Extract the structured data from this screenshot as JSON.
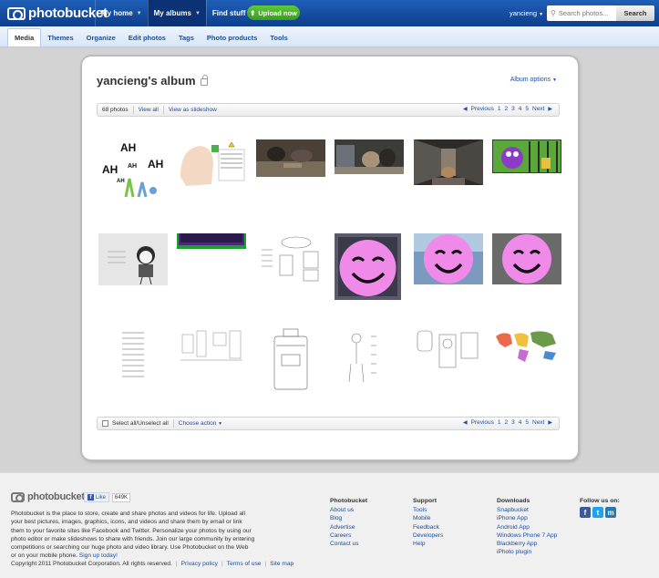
{
  "header": {
    "brand": "photobucket",
    "nav": [
      {
        "label": "My home"
      },
      {
        "label": "My albums"
      },
      {
        "label": "Find stuff"
      }
    ],
    "upload_label": "Upload now",
    "username": "yancieng",
    "search_placeholder": "Search photos...",
    "search_button": "Search"
  },
  "subnav": {
    "tabs": [
      "Media",
      "Themes",
      "Organize",
      "Edit photos",
      "Tags",
      "Photo products",
      "Tools"
    ],
    "active": "Media"
  },
  "album": {
    "title": "yancieng's album",
    "options_label": "Album options",
    "photo_count": "68 photos",
    "view_all": "View all",
    "slideshow": "View as slideshow",
    "pager": {
      "prev": "Previous",
      "pages": [
        "1",
        "2",
        "3",
        "4",
        "5"
      ],
      "next": "Next"
    },
    "select_all": "Select all/Unselect all",
    "choose_action": "Choose action",
    "thumbnails": [
      {
        "name": "ah-cartoon",
        "text": "AH"
      },
      {
        "name": "head-with-note"
      },
      {
        "name": "workshop-photo"
      },
      {
        "name": "dog-photo"
      },
      {
        "name": "construction-photo"
      },
      {
        "name": "purple-monster"
      },
      {
        "name": "girl-sketch"
      },
      {
        "name": "green-frame"
      },
      {
        "name": "note-sketch"
      },
      {
        "name": "smiley-face-1"
      },
      {
        "name": "smiley-face-2"
      },
      {
        "name": "smiley-face-3"
      },
      {
        "name": "text-sketch"
      },
      {
        "name": "room-sketch"
      },
      {
        "name": "suitcase-sketch"
      },
      {
        "name": "figure-sketch"
      },
      {
        "name": "machine-sketch"
      },
      {
        "name": "world-map-sketch"
      }
    ]
  },
  "footer": {
    "brand": "photobucket",
    "like_label": "Like",
    "like_count": "649K",
    "description": "Photobucket is the place to store, create and share photos and videos for life. Upload all your best pictures, images, graphics, icons, and videos and share them by email or link them to your favorite sites like Facebook and Twitter. Personalize your photos by using our photo editor or make slideshows to share with friends. Join our large community by entering competitions or searching our huge photo and video library. Use Photobucket on the Web or on your mobile phone.",
    "signup": "Sign up today!",
    "copyright": "Copyright 2011 Photobucket Corporation.  All rights reserved.",
    "legal_links": [
      "Privacy policy",
      "Terms of use",
      "Site map"
    ],
    "columns": [
      {
        "title": "Photobucket",
        "links": [
          "About us",
          "Blog",
          "Advertise",
          "Careers",
          "Contact us"
        ]
      },
      {
        "title": "Support",
        "links": [
          "Tools",
          "Mobile",
          "Feedback",
          "Developers",
          "Help"
        ]
      },
      {
        "title": "Downloads",
        "links": [
          "Snapbucket",
          "iPhone App",
          "Android App",
          "Windows Phone 7 App",
          "Blackberry App",
          "iPhoto plugin"
        ]
      }
    ],
    "follow_title": "Follow us on:"
  },
  "colors": {
    "brand_blue": "#1f5fb8",
    "upload_green": "#4cb22d",
    "link": "#1a4fa3",
    "smiley_pink": "#f08ae8"
  }
}
